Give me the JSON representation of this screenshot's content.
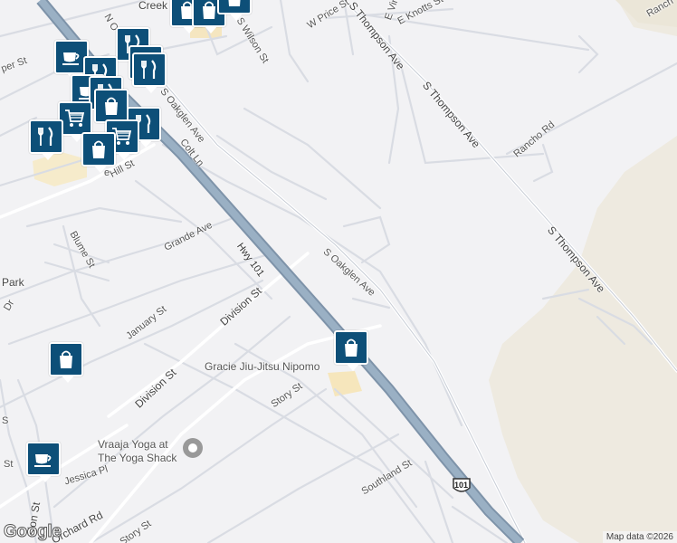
{
  "streets": [
    {
      "id": "hwy-101-label",
      "text": "Hwy 101"
    },
    {
      "id": "s-thompson-top",
      "text": "S Thompson Ave"
    },
    {
      "id": "s-thompson-mid",
      "text": "S Thompson Ave"
    },
    {
      "id": "s-thompson-right",
      "text": "S Thompson Ave"
    },
    {
      "id": "s-oakglen-top",
      "text": "S Oakglen Ave"
    },
    {
      "id": "s-oakglen-mid",
      "text": "S Oakglen Ave"
    },
    {
      "id": "w-price",
      "text": "W Price St"
    },
    {
      "id": "e-knotts",
      "text": "E Knotts St"
    },
    {
      "id": "e-vinta",
      "text": "E Vinta"
    },
    {
      "id": "s-wilson",
      "text": "S Wilson St"
    },
    {
      "id": "rancho-rd",
      "text": "Rancho Rd"
    },
    {
      "id": "ranch-top",
      "text": "Ranch"
    },
    {
      "id": "colt-ln",
      "text": "Colt Ln"
    },
    {
      "id": "hill-st",
      "text": "Hill St"
    },
    {
      "id": "grande-ave",
      "text": "Grande Ave"
    },
    {
      "id": "blume-st",
      "text": "Blume St"
    },
    {
      "id": "division-st-upper",
      "text": "Division St"
    },
    {
      "id": "division-st-lower",
      "text": "Division St"
    },
    {
      "id": "january-st",
      "text": "January St"
    },
    {
      "id": "story-st-mid",
      "text": "Story St"
    },
    {
      "id": "story-st-low",
      "text": "Story St"
    },
    {
      "id": "southland-st",
      "text": "Southland St"
    },
    {
      "id": "jessica-pl",
      "text": "Jessica Pl"
    },
    {
      "id": "orchard-rd",
      "text": "Orchard Rd"
    },
    {
      "id": "sion-st",
      "text": "sion St"
    },
    {
      "id": "per-st",
      "text": "per St"
    },
    {
      "id": "n-st",
      "text": "N O"
    },
    {
      "id": "park",
      "text": "Park"
    },
    {
      "id": "creek",
      "text": "Creek"
    },
    {
      "id": "dr-left",
      "text": "Dr"
    },
    {
      "id": "s-left",
      "text": "S"
    },
    {
      "id": "e-frag",
      "text": "e"
    },
    {
      "id": "st-frag",
      "text": "St"
    }
  ],
  "places": [
    {
      "id": "gracie",
      "text": "Gracie Jiu-Jitsu Nipomo"
    },
    {
      "id": "yoga-line1",
      "text": "Vraaja Yoga at"
    },
    {
      "id": "yoga-line2",
      "text": "The Yoga Shack"
    }
  ],
  "shield": {
    "route": "101"
  },
  "pins": [
    {
      "id": "pin-shop-top1",
      "icon": "shopping-bag-icon"
    },
    {
      "id": "pin-shop-top2",
      "icon": "shopping-bag-icon"
    },
    {
      "id": "pin-shop-top3",
      "icon": "shopping-bag-icon"
    },
    {
      "id": "pin-food-1",
      "icon": "restaurant-icon"
    },
    {
      "id": "pin-coffee-1",
      "icon": "coffee-icon"
    },
    {
      "id": "pin-food-2",
      "icon": "restaurant-icon"
    },
    {
      "id": "pin-food-3",
      "icon": "restaurant-icon"
    },
    {
      "id": "pin-food-4",
      "icon": "restaurant-icon"
    },
    {
      "id": "pin-coffee-2",
      "icon": "coffee-icon"
    },
    {
      "id": "pin-food-5",
      "icon": "restaurant-icon"
    },
    {
      "id": "pin-shop-1",
      "icon": "shopping-bag-icon"
    },
    {
      "id": "pin-cart-1",
      "icon": "shopping-cart-icon"
    },
    {
      "id": "pin-food-6",
      "icon": "restaurant-icon"
    },
    {
      "id": "pin-cart-2",
      "icon": "shopping-cart-icon"
    },
    {
      "id": "pin-food-7",
      "icon": "restaurant-icon"
    },
    {
      "id": "pin-shop-2",
      "icon": "shopping-bag-icon"
    },
    {
      "id": "pin-shop-gracie",
      "icon": "shopping-bag-icon"
    },
    {
      "id": "pin-shop-left",
      "icon": "shopping-bag-icon"
    },
    {
      "id": "pin-coffee-3",
      "icon": "coffee-icon"
    }
  ],
  "logo": "Google",
  "credit": "Map data ©2026",
  "colors": {
    "background": "#f2f2f4",
    "land": "#f0ede4",
    "highway": "#8fa4b8",
    "road": "#ffffff",
    "pin": "#0d4f78",
    "poi": "#f7e9c2"
  }
}
